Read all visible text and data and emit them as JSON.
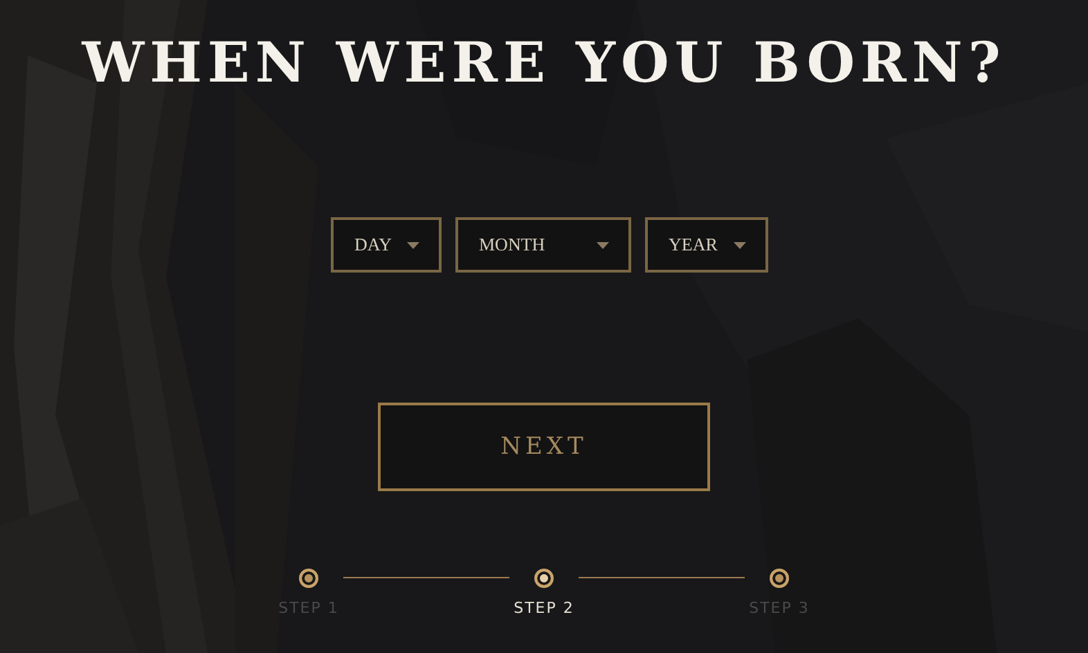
{
  "kind": "picture",
  "title": "WHEN WERE YOU BORN?",
  "dropdowns": [
    {
      "placeholder": "DAY"
    },
    {
      "placeholder": "MONTH"
    },
    {
      "placeholder": "YEAR"
    }
  ],
  "next_button": "NEXT",
  "steps": [
    {
      "label": "STEP 1",
      "selected": false
    },
    {
      "label": "STEP 2",
      "selected": true
    },
    {
      "label": "STEP 3",
      "selected": false
    }
  ]
}
